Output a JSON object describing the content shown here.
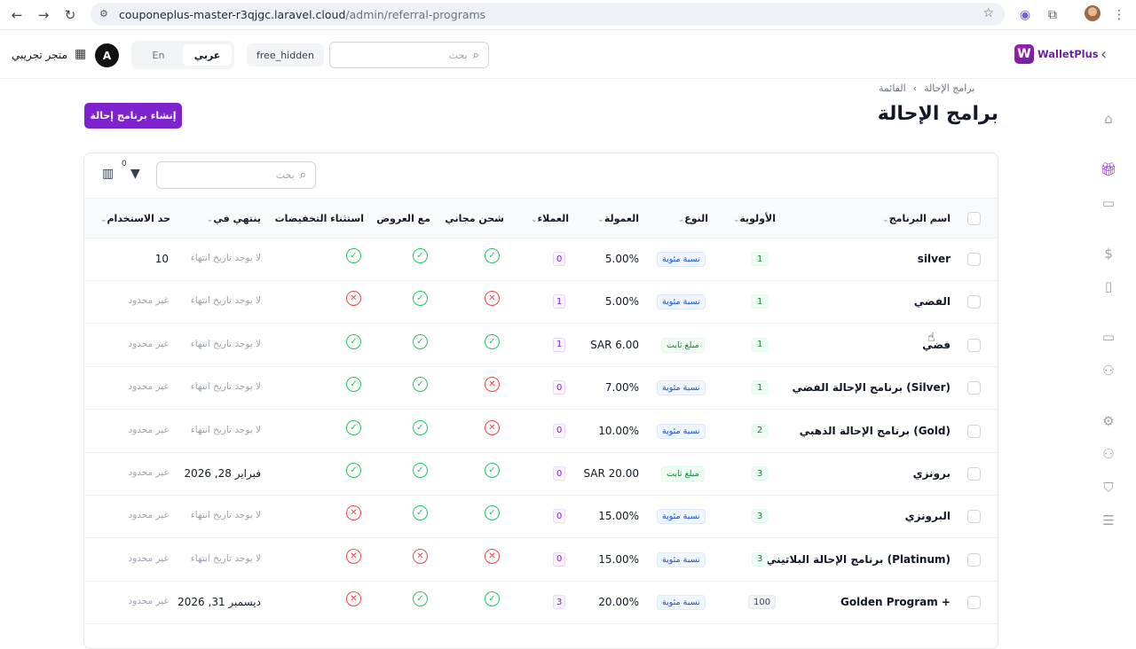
{
  "browser": {
    "url_host": "couponeplus-master-r3qjgc.laravel.cloud",
    "url_path": "/admin/referral-programs"
  },
  "header": {
    "logo_text": "WalletPlus",
    "search_placeholder": "بحث",
    "chip_label": "free_hidden",
    "lang_en": "En",
    "lang_ar": "عربي",
    "avatar_letter": "A",
    "store_name": "متجر تجريبي"
  },
  "page": {
    "breadcrumb_parent": "برامج الإحالة",
    "breadcrumb_separator": "›",
    "breadcrumb_current": "القائمة",
    "title": "برامج الإحالة",
    "create_button": "إنشاء برنامج إحالة"
  },
  "table": {
    "search_placeholder": "بحث",
    "filter_count": "0",
    "columns": {
      "name": "اسم البرنامج",
      "priority": "الأولوية",
      "type": "النوع",
      "commission": "العمولة",
      "customers": "العملاء",
      "free_shipping": "شحن مجاني",
      "with_offers": "مع العروض",
      "exclude_discounts": "استثناء التخفيضات",
      "ends_at": "ينتهي في",
      "usage_limit": "حد الاستخدام"
    },
    "rows": [
      {
        "name": "silver",
        "priority": "1",
        "type": "نسبة مئوية",
        "commission": "5.00%",
        "customers": "0",
        "free_shipping": true,
        "with_offers": true,
        "exclude_discounts": true,
        "ends_at": "لا يوجد تاريخ انتهاء",
        "usage_limit": "10"
      },
      {
        "name": "الفضي",
        "priority": "1",
        "type": "نسبة مئوية",
        "commission": "5.00%",
        "customers": "1",
        "free_shipping": false,
        "with_offers": true,
        "exclude_discounts": false,
        "ends_at": "لا يوجد تاريخ انتهاء",
        "usage_limit": "غير محدود"
      },
      {
        "name": "فضي",
        "priority": "1",
        "type": "مبلغ ثابت",
        "commission": "SAR 6.00",
        "customers": "1",
        "free_shipping": true,
        "with_offers": true,
        "exclude_discounts": true,
        "ends_at": "لا يوجد تاريخ انتهاء",
        "usage_limit": "غير محدود"
      },
      {
        "name": "برنامج الإحالة الفضي (Silver)",
        "priority": "1",
        "type": "نسبة مئوية",
        "commission": "7.00%",
        "customers": "0",
        "free_shipping": false,
        "with_offers": true,
        "exclude_discounts": true,
        "ends_at": "لا يوجد تاريخ انتهاء",
        "usage_limit": "غير محدود"
      },
      {
        "name": "برنامج الإحالة الذهبي (Gold)",
        "priority": "2",
        "type": "نسبة مئوية",
        "commission": "10.00%",
        "customers": "0",
        "free_shipping": false,
        "with_offers": true,
        "exclude_discounts": true,
        "ends_at": "لا يوجد تاريخ انتهاء",
        "usage_limit": "غير محدود"
      },
      {
        "name": "برونزي",
        "priority": "3",
        "type": "مبلغ ثابت",
        "commission": "SAR 20.00",
        "customers": "0",
        "free_shipping": true,
        "with_offers": true,
        "exclude_discounts": true,
        "ends_at": "فبراير 28, 2026",
        "usage_limit": "غير محدود"
      },
      {
        "name": "البرونزي",
        "priority": "3",
        "type": "نسبة مئوية",
        "commission": "15.00%",
        "customers": "0",
        "free_shipping": true,
        "with_offers": true,
        "exclude_discounts": false,
        "ends_at": "لا يوجد تاريخ انتهاء",
        "usage_limit": "غير محدود"
      },
      {
        "name": "برنامج الإحالة البلاتيني (Platinum)",
        "priority": "3",
        "type": "نسبة مئوية",
        "commission": "15.00%",
        "customers": "0",
        "free_shipping": false,
        "with_offers": false,
        "exclude_discounts": false,
        "ends_at": "لا يوجد تاريخ انتهاء",
        "usage_limit": "غير محدود"
      },
      {
        "name": "Golden Program +",
        "priority": "100",
        "type": "نسبة مئوية",
        "commission": "20.00%",
        "customers": "3",
        "free_shipping": true,
        "with_offers": true,
        "exclude_discounts": false,
        "ends_at": "ديسمبر 31, 2026",
        "usage_limit": "غير محدود"
      }
    ]
  },
  "colors": {
    "accent": "#7e22ce",
    "success": "#22c55e",
    "danger": "#ef4444"
  }
}
